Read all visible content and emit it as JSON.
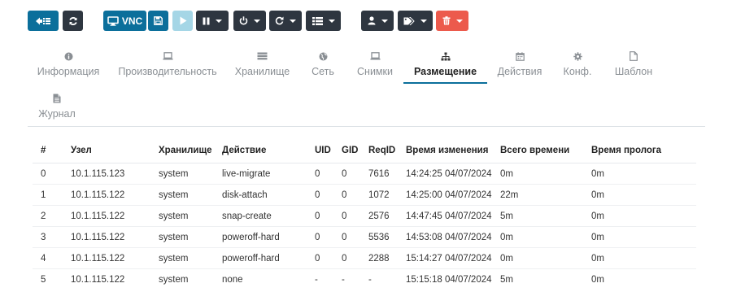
{
  "toolbar": {
    "vnc_label": "VNC"
  },
  "tabs": [
    {
      "label": "Информация",
      "icon": "info-icon"
    },
    {
      "label": "Производительность",
      "icon": "laptop-icon"
    },
    {
      "label": "Хранилище",
      "icon": "storage-icon"
    },
    {
      "label": "Сеть",
      "icon": "globe-icon"
    },
    {
      "label": "Снимки",
      "icon": "laptop-icon"
    },
    {
      "label": "Размещение",
      "icon": "sitemap-icon",
      "active": true
    },
    {
      "label": "Действия",
      "icon": "calendar-icon"
    },
    {
      "label": "Конф.",
      "icon": "gear-icon"
    },
    {
      "label": "Шаблон",
      "icon": "file-icon"
    },
    {
      "label": "Журнал",
      "icon": "file-text-icon"
    }
  ],
  "table": {
    "headers": [
      "#",
      "Узел",
      "Хранилище",
      "Действие",
      "UID",
      "GID",
      "ReqID",
      "Время изменения",
      "Всего времени",
      "Время пролога"
    ],
    "rows": [
      [
        "0",
        "10.1.115.123",
        "system",
        "live-migrate",
        "0",
        "0",
        "7616",
        "14:24:25 04/07/2024",
        "0m",
        "0m"
      ],
      [
        "1",
        "10.1.115.122",
        "system",
        "disk-attach",
        "0",
        "0",
        "1072",
        "14:25:00 04/07/2024",
        "22m",
        "0m"
      ],
      [
        "2",
        "10.1.115.122",
        "system",
        "snap-create",
        "0",
        "0",
        "2576",
        "14:47:45 04/07/2024",
        "5m",
        "0m"
      ],
      [
        "3",
        "10.1.115.122",
        "system",
        "poweroff-hard",
        "0",
        "0",
        "5536",
        "14:53:08 04/07/2024",
        "0m",
        "0m"
      ],
      [
        "4",
        "10.1.115.122",
        "system",
        "poweroff-hard",
        "0",
        "0",
        "2288",
        "15:14:27 04/07/2024",
        "0m",
        "0m"
      ],
      [
        "5",
        "10.1.115.122",
        "system",
        "none",
        "-",
        "-",
        "-",
        "15:15:18 04/07/2024",
        "5m",
        "0m"
      ]
    ]
  },
  "colors": {
    "primary": "#0b6f9b",
    "primary_disabled": "#a5d6e6",
    "dark": "#2e3640",
    "danger": "#ec5a4c"
  }
}
